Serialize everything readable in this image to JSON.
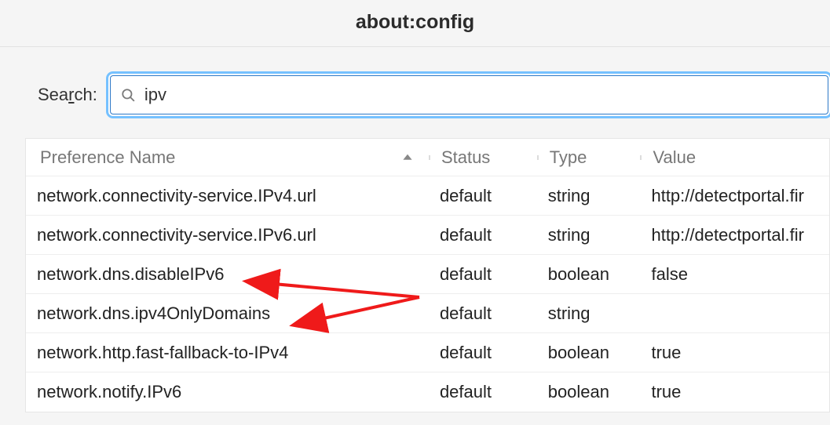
{
  "header": {
    "title": "about:config"
  },
  "search": {
    "label_pre": "Sea",
    "label_u": "r",
    "label_post": "ch:",
    "value": "ipv",
    "placeholder": ""
  },
  "columns": {
    "name": "Preference Name",
    "status": "Status",
    "type": "Type",
    "value": "Value"
  },
  "rows": [
    {
      "name": "network.connectivity-service.IPv4.url",
      "status": "default",
      "type": "string",
      "value": "http://detectportal.fir"
    },
    {
      "name": "network.connectivity-service.IPv6.url",
      "status": "default",
      "type": "string",
      "value": "http://detectportal.fir"
    },
    {
      "name": "network.dns.disableIPv6",
      "status": "default",
      "type": "boolean",
      "value": "false"
    },
    {
      "name": "network.dns.ipv4OnlyDomains",
      "status": "default",
      "type": "string",
      "value": ""
    },
    {
      "name": "network.http.fast-fallback-to-IPv4",
      "status": "default",
      "type": "boolean",
      "value": "true"
    },
    {
      "name": "network.notify.IPv6",
      "status": "default",
      "type": "boolean",
      "value": "true"
    }
  ]
}
